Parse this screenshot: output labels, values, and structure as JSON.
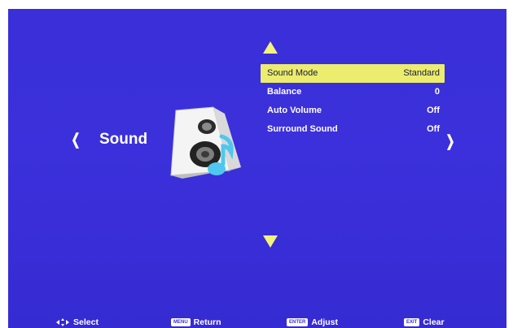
{
  "category": {
    "title": "Sound",
    "prev_glyph": "❮",
    "next_glyph": "❯",
    "icon": "speaker-icon"
  },
  "menu": {
    "items": [
      {
        "label": "Sound Mode",
        "value": "Standard",
        "selected": true
      },
      {
        "label": "Balance",
        "value": "0",
        "selected": false
      },
      {
        "label": "Auto Volume",
        "value": "Off",
        "selected": false
      },
      {
        "label": "Surround Sound",
        "value": "Off",
        "selected": false
      }
    ]
  },
  "footer": {
    "select_label": "Select",
    "menu_key": "MENU",
    "return_label": "Return",
    "enter_key": "ENTER",
    "adjust_label": "Adjust",
    "exit_key": "EXIT",
    "clear_label": "Clear"
  },
  "colors": {
    "background": "#3a2fd8",
    "highlight": "#ecec6e",
    "arrow": "#f2f27c",
    "text": "#ffffff"
  }
}
